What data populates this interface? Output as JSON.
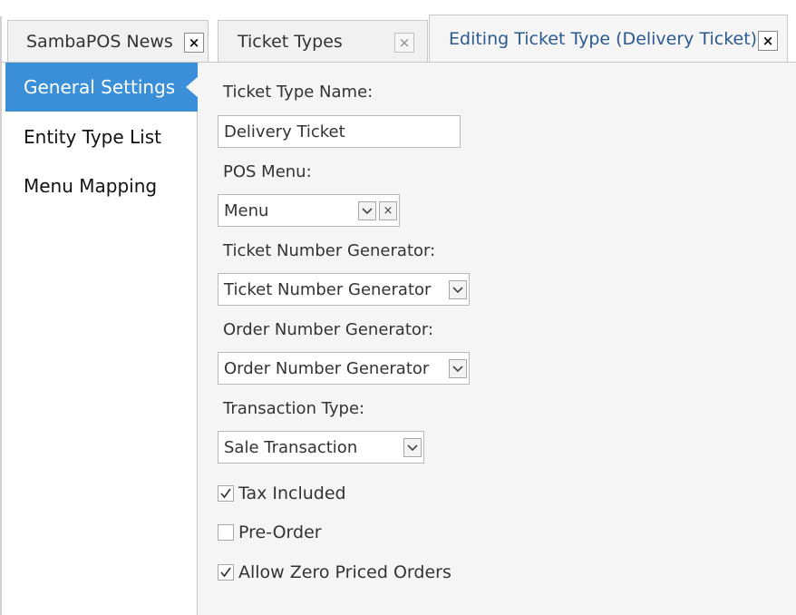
{
  "tabs": [
    {
      "label": "SambaPOS News",
      "close": "×"
    },
    {
      "label": "Ticket Types",
      "close": "×"
    },
    {
      "label": "Editing Ticket Type (Delivery Ticket)",
      "close": "×",
      "active": true
    }
  ],
  "sidebar": {
    "items": [
      {
        "label": "General Settings",
        "selected": true
      },
      {
        "label": "Entity Type List"
      },
      {
        "label": "Menu Mapping"
      }
    ]
  },
  "form": {
    "ticket_type_name_label": "Ticket Type Name:",
    "ticket_type_name_value": "Delivery Ticket",
    "pos_menu_label": "POS Menu:",
    "pos_menu_value": "Menu",
    "pos_menu_clear": "×",
    "ticket_number_generator_label": "Ticket Number Generator:",
    "ticket_number_generator_value": "Ticket Number Generator",
    "order_number_generator_label": "Order Number Generator:",
    "order_number_generator_value": "Order Number Generator",
    "transaction_type_label": "Transaction Type:",
    "transaction_type_value": "Sale Transaction",
    "checkboxes": [
      {
        "label": "Tax Included",
        "checked": true
      },
      {
        "label": "Pre-Order",
        "checked": false
      },
      {
        "label": "Allow Zero Priced Orders",
        "checked": true
      }
    ]
  },
  "colors": {
    "accent": "#3a8fd8",
    "active_tab_text": "#2c5a8e",
    "content_bg": "#f5f5f5"
  }
}
